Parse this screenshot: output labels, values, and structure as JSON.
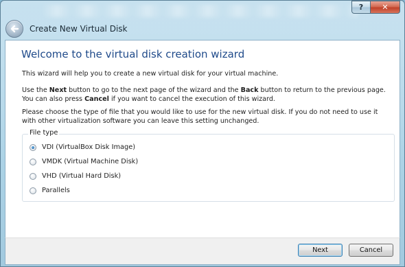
{
  "window": {
    "title": "Create New Virtual Disk",
    "help_label": "?",
    "close_label": "✕"
  },
  "page": {
    "heading": "Welcome to the virtual disk creation wizard",
    "intro": "This wizard will help you to create a new virtual disk for your virtual machine.",
    "nav_text": {
      "p1": "Use the ",
      "next_word": "Next",
      "p2": " button to go to the next page of the wizard and the ",
      "back_word": "Back",
      "p3": " button to return to the previous page. You can also press ",
      "cancel_word": "Cancel",
      "p4": " if you want to cancel the execution of this wizard."
    },
    "choose_text": "Please choose the type of file that you would like to use for the new virtual disk. If you do not need to use it with other virtualization software you can leave this setting unchanged."
  },
  "file_type": {
    "label": "File type",
    "options": [
      {
        "label": "VDI (VirtualBox Disk Image)",
        "checked": true
      },
      {
        "label": "VMDK (Virtual Machine Disk)",
        "checked": false
      },
      {
        "label": "VHD (Virtual Hard Disk)",
        "checked": false
      },
      {
        "label": "Parallels",
        "checked": false
      }
    ]
  },
  "buttons": {
    "next": "Next",
    "cancel": "Cancel"
  },
  "colors": {
    "heading": "#1f4a8a",
    "frame": "#a8d0e2",
    "default_button_border": "#3c7fb1"
  },
  "icons": {
    "back": "back-arrow-icon",
    "help": "help-icon",
    "close": "close-icon"
  }
}
